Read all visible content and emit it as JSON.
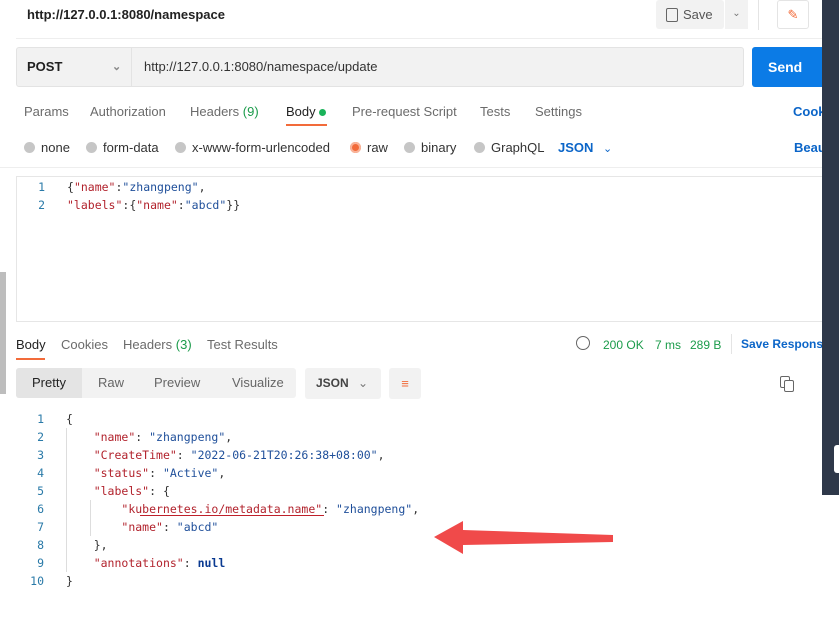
{
  "header": {
    "title": "http://127.0.0.1:8080/namespace",
    "save_label": "Save"
  },
  "request": {
    "method": "POST",
    "url": "http://127.0.0.1:8080/namespace/update",
    "send_label": "Send"
  },
  "req_tabs": [
    {
      "label": "Params"
    },
    {
      "label": "Authorization"
    },
    {
      "label": "Headers",
      "count": "(9)"
    },
    {
      "label": "Body"
    },
    {
      "label": "Pre-request Script"
    },
    {
      "label": "Tests"
    },
    {
      "label": "Settings"
    }
  ],
  "cookies_label": "Cook",
  "body_types": [
    "none",
    "form-data",
    "x-www-form-urlencoded",
    "raw",
    "binary",
    "GraphQL"
  ],
  "selected_body_type": "raw",
  "body_format": "JSON",
  "beautify_label": "Beau",
  "request_body": [
    [
      {
        "c": "p",
        "t": "{"
      },
      {
        "c": "key",
        "t": "\"name\""
      },
      {
        "c": "p",
        "t": ":"
      },
      {
        "c": "str",
        "t": "\"zhangpeng\""
      },
      {
        "c": "p",
        "t": ","
      }
    ],
    [
      {
        "c": "key",
        "t": "\"labels\""
      },
      {
        "c": "p",
        "t": ":{"
      },
      {
        "c": "key",
        "t": "\"name\""
      },
      {
        "c": "p",
        "t": ":"
      },
      {
        "c": "str",
        "t": "\"abcd\""
      },
      {
        "c": "p",
        "t": "}}"
      }
    ]
  ],
  "resp_tabs": [
    {
      "label": "Body"
    },
    {
      "label": "Cookies"
    },
    {
      "label": "Headers",
      "count": "(3)"
    },
    {
      "label": "Test Results"
    }
  ],
  "status": {
    "code": "200 OK",
    "time": "7 ms",
    "size": "289 B",
    "save_label": "Save Respons"
  },
  "view_modes": [
    "Pretty",
    "Raw",
    "Preview",
    "Visualize"
  ],
  "resp_format": "JSON",
  "response_body": [
    [
      {
        "c": "p",
        "t": "{"
      }
    ],
    [
      {
        "c": "p",
        "t": "    "
      },
      {
        "c": "key",
        "t": "\"name\""
      },
      {
        "c": "p",
        "t": ": "
      },
      {
        "c": "str",
        "t": "\"zhangpeng\""
      },
      {
        "c": "p",
        "t": ","
      }
    ],
    [
      {
        "c": "p",
        "t": "    "
      },
      {
        "c": "key",
        "t": "\"CreateTime\""
      },
      {
        "c": "p",
        "t": ": "
      },
      {
        "c": "str",
        "t": "\"2022-06-21T20:26:38+08:00\""
      },
      {
        "c": "p",
        "t": ","
      }
    ],
    [
      {
        "c": "p",
        "t": "    "
      },
      {
        "c": "key",
        "t": "\"status\""
      },
      {
        "c": "p",
        "t": ": "
      },
      {
        "c": "str",
        "t": "\"Active\""
      },
      {
        "c": "p",
        "t": ","
      }
    ],
    [
      {
        "c": "p",
        "t": "    "
      },
      {
        "c": "key",
        "t": "\"labels\""
      },
      {
        "c": "p",
        "t": ": {"
      }
    ],
    [
      {
        "c": "p",
        "t": "        "
      },
      {
        "c": "key",
        "t": "\"kubernetes.io/metadata.name\""
      },
      {
        "c": "p",
        "t": ": "
      },
      {
        "c": "str",
        "t": "\"zhangpeng\""
      },
      {
        "c": "p",
        "t": ","
      }
    ],
    [
      {
        "c": "p",
        "t": "        "
      },
      {
        "c": "key",
        "t": "\"name\""
      },
      {
        "c": "p",
        "t": ": "
      },
      {
        "c": "str",
        "t": "\"abcd\""
      }
    ],
    [
      {
        "c": "p",
        "t": "    },"
      }
    ],
    [
      {
        "c": "p",
        "t": "    "
      },
      {
        "c": "key",
        "t": "\"annotations\""
      },
      {
        "c": "p",
        "t": ": "
      },
      {
        "c": "kw",
        "t": "null"
      }
    ],
    [
      {
        "c": "p",
        "t": "}"
      }
    ]
  ],
  "colors": {
    "accent": "#f26b3a",
    "send": "#0b7be6",
    "ok": "#1a9b4a",
    "link": "#0b65c8",
    "annotation_arrow": "#f04a4a"
  }
}
